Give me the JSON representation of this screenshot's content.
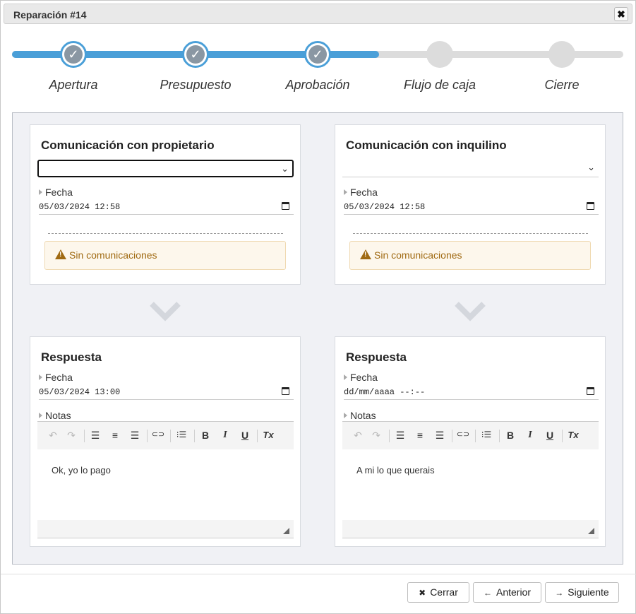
{
  "dialog": {
    "title": "Reparación #14",
    "close_label": "✖"
  },
  "stepper": {
    "progress_percent": 60,
    "steps": [
      {
        "label": "Apertura",
        "status": "done"
      },
      {
        "label": "Presupuesto",
        "status": "done"
      },
      {
        "label": "Aprobación",
        "status": "done"
      },
      {
        "label": "Flujo de caja",
        "status": "pending"
      },
      {
        "label": "Cierre",
        "status": "pending"
      }
    ],
    "check_glyph": "✓"
  },
  "owner": {
    "title": "Comunicación con propietario",
    "select_value": "",
    "fecha_label": "Fecha",
    "fecha_value": "05/03/2024 12:58",
    "warning": "Sin comunicaciones",
    "response": {
      "title": "Respuesta",
      "fecha_label": "Fecha",
      "fecha_value": "05/03/2024 13:00",
      "notas_label": "Notas",
      "notes_text": "Ok, yo lo pago"
    }
  },
  "tenant": {
    "title": "Comunicación con inquilino",
    "select_value": "",
    "fecha_label": "Fecha",
    "fecha_value": "05/03/2024 12:58",
    "warning": "Sin comunicaciones",
    "response": {
      "title": "Respuesta",
      "fecha_label": "Fecha",
      "fecha_value": "dd/mm/aaaa --:--",
      "notas_label": "Notas",
      "notes_text": "A mi lo que querais"
    }
  },
  "toolbar_glyphs": {
    "undo": "↶",
    "redo": "↷",
    "align_left": "☰",
    "align_center": "≡",
    "align_right": "☰",
    "link": "⊂⊃",
    "list": "⁝☰",
    "bold": "B",
    "italic": "I",
    "underline": "U",
    "clear": "Tx"
  },
  "buttons": {
    "close": {
      "icon": "✖",
      "label": "Cerrar"
    },
    "prev": {
      "icon": "←",
      "label": "Anterior"
    },
    "next": {
      "icon": "→",
      "label": "Siguiente"
    }
  },
  "colors": {
    "accent": "#4a9fd8",
    "warning_text": "#a06a12",
    "warning_bg": "#fdf7ec"
  }
}
